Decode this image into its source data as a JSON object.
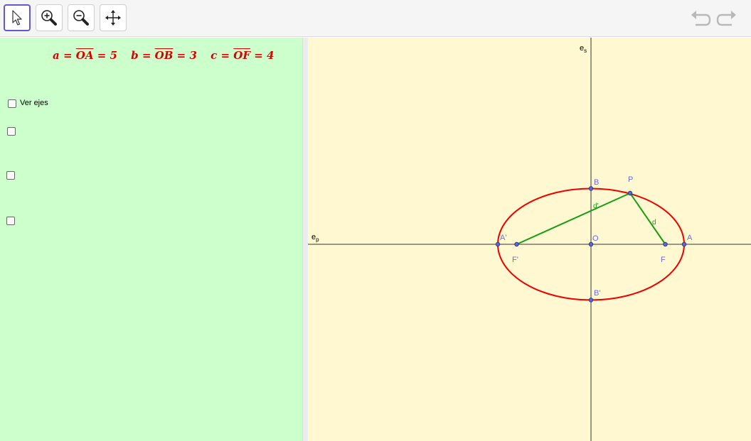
{
  "toolbar": {
    "tools": [
      {
        "name": "move-tool",
        "icon": "pointer-arrow-icon",
        "active": true
      },
      {
        "name": "zoom-in-tool",
        "icon": "zoom-in-icon",
        "active": false
      },
      {
        "name": "zoom-out-tool",
        "icon": "zoom-out-icon",
        "active": false
      },
      {
        "name": "move-graphics-view-tool",
        "icon": "move-arrows-icon",
        "active": false
      }
    ],
    "undo_icon": "undo-icon",
    "redo_icon": "redo-icon"
  },
  "algebra": {
    "formula": {
      "a_var": "a",
      "a_seg": "OA",
      "a_val": "5",
      "b_var": "b",
      "b_seg": "OB",
      "b_val": "3",
      "c_var": "c",
      "c_seg": "OF",
      "c_val": "4"
    },
    "checkboxes": [
      {
        "label": "Ver ejes",
        "checked": false
      },
      {
        "label": "",
        "checked": false
      },
      {
        "label": "",
        "checked": false
      },
      {
        "label": "",
        "checked": false
      }
    ]
  },
  "graphics": {
    "axis_labels": {
      "horizontal": "e",
      "horizontal_sub": "p",
      "vertical": "e",
      "vertical_sub": "s"
    },
    "points": {
      "A": "A",
      "A_prime": "A'",
      "B": "B",
      "B_prime": "B'",
      "F": "F",
      "F_prime": "F'",
      "O": "O",
      "P": "P"
    },
    "segments": {
      "d": "d",
      "d_prime": "d'"
    },
    "colors": {
      "ellipse": "#ee0000",
      "segments": "#169e16",
      "point_fill": "#5a67d8",
      "point_label": "#6a6af0",
      "axis": "#333333",
      "algebra_bg": "#ccffcc",
      "graphics_bg": "#fff8d0",
      "formula": "#dd0000"
    }
  }
}
